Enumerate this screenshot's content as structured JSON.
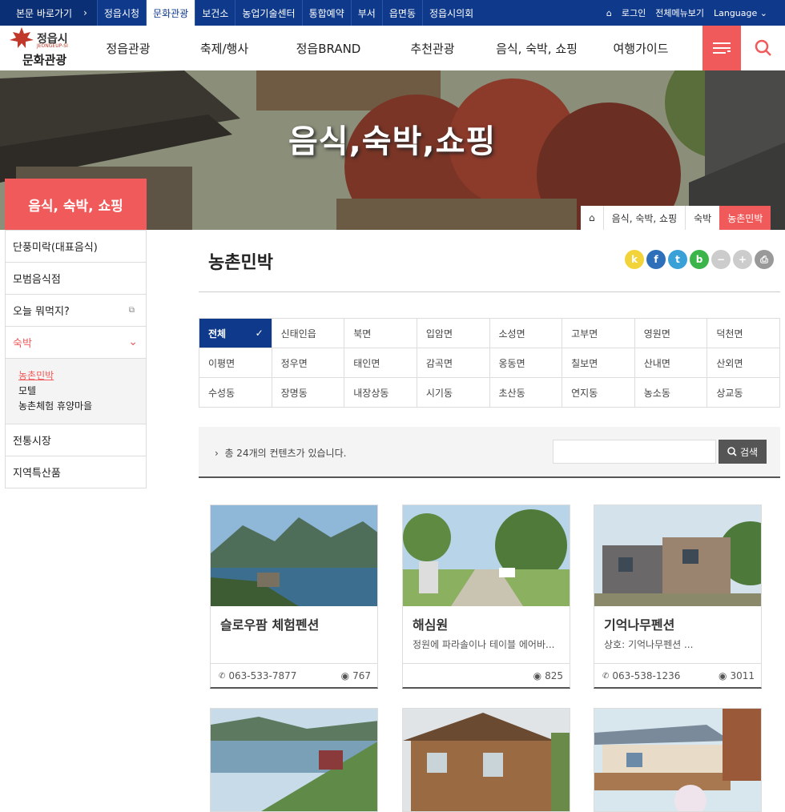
{
  "topbar": {
    "skip": "본문 바로가기",
    "items": [
      "정읍시청",
      "문화관광",
      "보건소",
      "농업기술센터",
      "통합예약",
      "부서",
      "읍면동",
      "정읍시의회"
    ],
    "active": "문화관광",
    "login": "로그인",
    "sitemap": "전체메뉴보기",
    "language": "Language"
  },
  "logo": {
    "small": "정읍시",
    "eng": "JEONGEUP-SI",
    "big": "문화관광"
  },
  "gnb": [
    "정읍관광",
    "축제/행사",
    "정읍BRAND",
    "추천관광",
    "음식, 숙박, 쇼핑",
    "여행가이드"
  ],
  "hero": {
    "title": "음식,숙박,쇼핑"
  },
  "location": [
    "음식, 숙박, 쇼핑",
    "숙박",
    "농촌민박"
  ],
  "sidebar": {
    "title": "음식, 숙박, 쇼핑",
    "items": [
      "단풍미락(대표음식)",
      "모범음식점",
      "오늘 뭐먹지?",
      "숙박"
    ],
    "sub": [
      "농촌민박",
      "모텔",
      "농촌체험 휴양마을"
    ],
    "items2": [
      "전통시장",
      "지역특산품"
    ]
  },
  "page": {
    "title": "농촌민박"
  },
  "share": [
    "k",
    "f",
    "t",
    "b",
    "−",
    "+",
    "⎙"
  ],
  "filters": [
    [
      "전체",
      "신태인읍",
      "북면",
      "입암면",
      "소성면",
      "고부면",
      "영원면",
      "덕천면"
    ],
    [
      "이평면",
      "정우면",
      "태인면",
      "감곡면",
      "옹동면",
      "칠보면",
      "산내면",
      "산외면"
    ],
    [
      "수성동",
      "장명동",
      "내장상동",
      "시기동",
      "초산동",
      "연지동",
      "농소동",
      "상교동"
    ]
  ],
  "search": {
    "count": "총 24개의 컨텐츠가 있습니다.",
    "button": "검색"
  },
  "cards": [
    {
      "title": "슬로우팜 체험펜션",
      "desc": "",
      "tel": "063-533-7877",
      "views": "767"
    },
    {
      "title": "해심원",
      "desc": "정원에 파라솔이나 테이블 에어바...",
      "tel": "",
      "views": "825"
    },
    {
      "title": "기억나무펜션",
      "desc": "상호: 기억나무펜션 ...",
      "tel": "063-538-1236",
      "views": "3011"
    }
  ]
}
